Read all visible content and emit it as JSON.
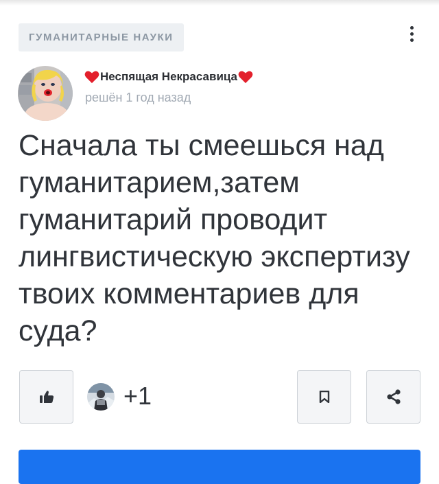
{
  "question": {
    "subject": "ГУМАНИТАРНЫЕ НАУКИ",
    "author": {
      "name": "Неспящая Некрасавица",
      "decoration": "heart-icon"
    },
    "status": "решён 1 год назад",
    "text": "Сначала ты смеешься над гуманитарием,затем гуманитарий проводит лингвистическую экспертизу твоих комментариев для суда?"
  },
  "actions": {
    "like_icon": "thumbs-up-icon",
    "thanks_count": "+1",
    "bookmark_icon": "bookmark-icon",
    "share_icon": "share-icon"
  },
  "colors": {
    "heart": "#e3202c",
    "tag_background": "#edf0f3",
    "tag_text": "#8c97a3",
    "text_primary": "#30343a",
    "text_secondary": "#a1a9b3",
    "button_border": "#cdd2d7",
    "accent": "#1a73f0"
  }
}
